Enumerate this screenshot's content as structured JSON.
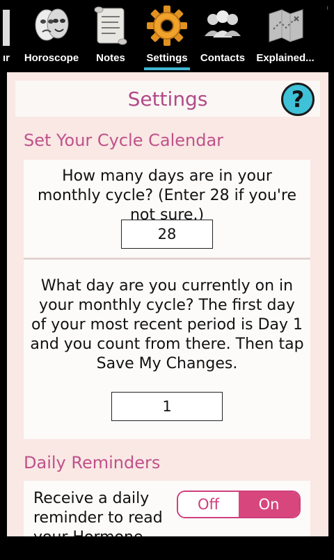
{
  "tabs": [
    {
      "label": "ır",
      "icon": "calendar-icon"
    },
    {
      "label": "Horoscope",
      "icon": "theater-masks-icon"
    },
    {
      "label": "Notes",
      "icon": "scroll-icon"
    },
    {
      "label": "Settings",
      "icon": "gear-icon",
      "active": true
    },
    {
      "label": "Contacts",
      "icon": "people-icon"
    },
    {
      "label": "Explained...",
      "icon": "map-icon"
    }
  ],
  "header": {
    "title": "Settings",
    "help_glyph": "?"
  },
  "cycle_section": {
    "title": "Set Your Cycle Calendar",
    "q1": "How many days are in your monthly cycle? (Enter 28 if you're not sure.)",
    "q1_value": "28",
    "q2": "What day are you currently on in your monthly cycle? The first day of your most recent period is Day 1 and you count from there. Then tap Save My Changes.",
    "q2_value": "1"
  },
  "reminder_section": {
    "title": "Daily Reminders",
    "text": "Receive a daily reminder to read your Hormone",
    "toggle_off": "Off",
    "toggle_on": "On",
    "toggle_state": "On"
  },
  "colors": {
    "accent": "#c0518a",
    "toggle": "#d8467e",
    "help": "#3fc1d8",
    "tab_underline": "#3fb6d3",
    "panel": "#f9e8e4"
  }
}
